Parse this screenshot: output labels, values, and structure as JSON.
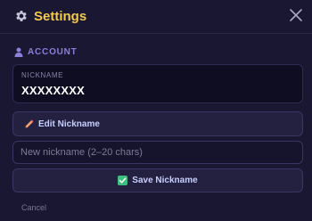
{
  "header": {
    "title": "Settings",
    "icon": "gear-icon",
    "close_icon": "close-icon",
    "title_color": "#f2c94c"
  },
  "account": {
    "section_label": "ACCOUNT",
    "icon": "user-icon",
    "nickname_label": "NICKNAME",
    "nickname_value": "XXXXXXXX"
  },
  "actions": {
    "edit_label": "Edit Nickname",
    "edit_icon": "pencil-icon",
    "new_nickname_placeholder": "New nickname (2–20 chars)",
    "new_nickname_value": "",
    "save_label": "Save Nickname",
    "save_icon": "check-icon",
    "cancel_label": "Cancel"
  },
  "colors": {
    "background": "#1a1733",
    "accent": "#8b7fd9",
    "button_text": "#c8d0ff",
    "save_check": "#3fbf7f"
  }
}
